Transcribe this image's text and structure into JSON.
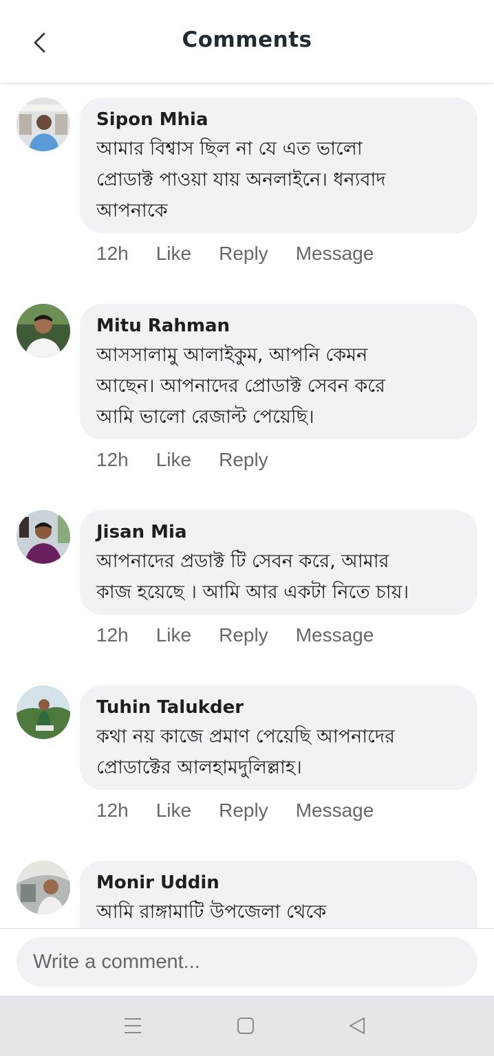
{
  "header": {
    "title": "Comments",
    "back_icon": "back-chevron-icon"
  },
  "comments": [
    {
      "name": "Sipon Mhia",
      "lines": [
        "আমার বিশ্বাস ছিল না যে এত ভালো",
        "প্রোডাক্ট পাওয়া যায় অনলাইনে। ধন্যবাদ",
        "আপনাকে"
      ],
      "time": "12h",
      "like": "Like",
      "reply": "Reply",
      "message": "Message"
    },
    {
      "name": "Mitu Rahman",
      "lines": [
        "আসসালামু আলাইকুম, আপনি কেমন",
        "আছেন। আপনাদের প্রোডাক্ট সেবন করে",
        "আমি ভালো রেজাল্ট পেয়েছি।"
      ],
      "time": "12h",
      "like": "Like",
      "reply": "Reply"
    },
    {
      "name": "Jisan Mia",
      "lines": [
        "আপনাদের প্রডাক্ট টি সেবন করে, আমার",
        "কাজ হয়েছে । আমি আর একটা নিতে চায়।"
      ],
      "time": "12h",
      "like": "Like",
      "reply": "Reply",
      "message": "Message"
    },
    {
      "name": "Tuhin Talukder",
      "lines": [
        "কথা নয় কাজে প্রমাণ পেয়েছি আপনাদের",
        "প্রোডাক্টের আলহামদুলিল্লাহ।"
      ],
      "time": "12h",
      "like": "Like",
      "reply": "Reply",
      "message": "Message"
    },
    {
      "name": "Monir Uddin",
      "lines": [
        "আমি রাঙ্গামাটি উপজেলা থেকে"
      ]
    }
  ],
  "composer": {
    "placeholder": "Write a comment..."
  },
  "navbar": {
    "icons": [
      "menu-icon",
      "home-square-icon",
      "back-triangle-icon"
    ]
  },
  "colors": {
    "bubble": "#f0f2f5",
    "meta_text": "#65676b",
    "nav_bg": "#e6e6ea"
  }
}
